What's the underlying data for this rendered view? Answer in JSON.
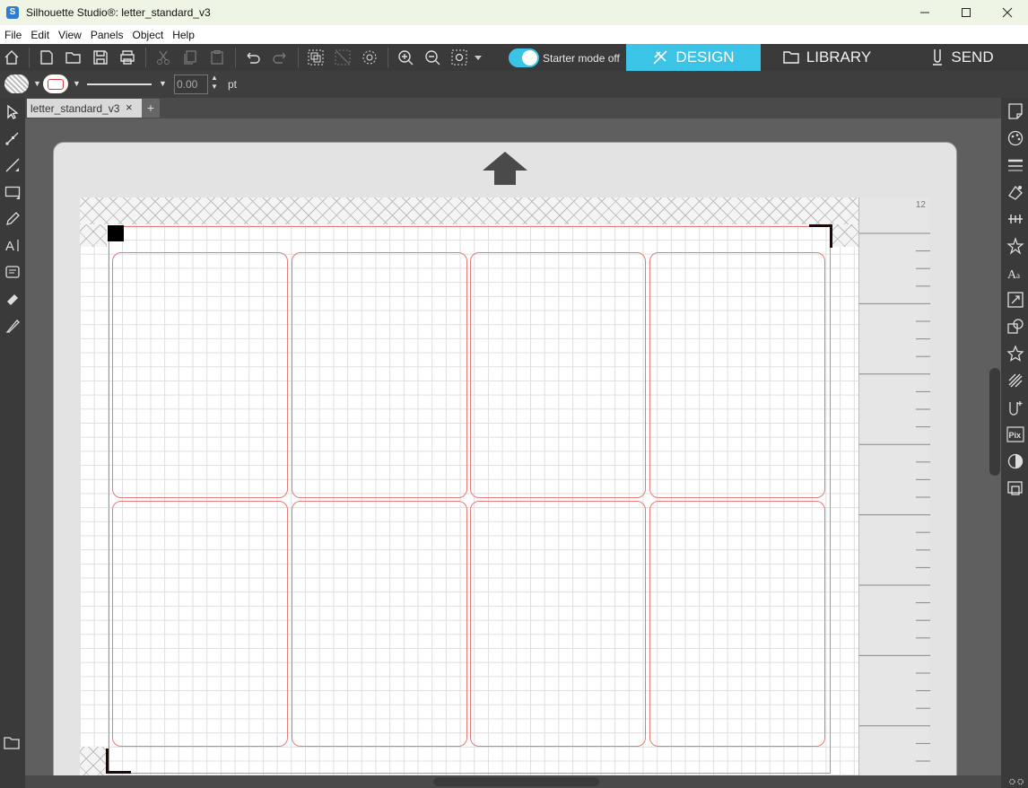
{
  "window": {
    "title": "Silhouette Studio®: letter_standard_v3",
    "app_icon_letter": "S"
  },
  "menu": [
    "File",
    "Edit",
    "View",
    "Panels",
    "Object",
    "Help"
  ],
  "toolbar": {
    "starter_mode_label": "Starter mode off",
    "tabs": {
      "design": "DESIGN",
      "library": "LIBRARY",
      "send": "SEND"
    },
    "accent_color": "#3cc4e6"
  },
  "properties": {
    "line_width_value": "0.00",
    "line_width_unit": "pt",
    "stroke_color": "#d63a3a"
  },
  "document": {
    "tab_name": "letter_standard_v3",
    "close_glyph": "×",
    "add_glyph": "+"
  },
  "ruler": {
    "label": "12"
  },
  "layout_grid": {
    "rows": 2,
    "columns": 4,
    "cut_line_color": "#e57a7a"
  }
}
